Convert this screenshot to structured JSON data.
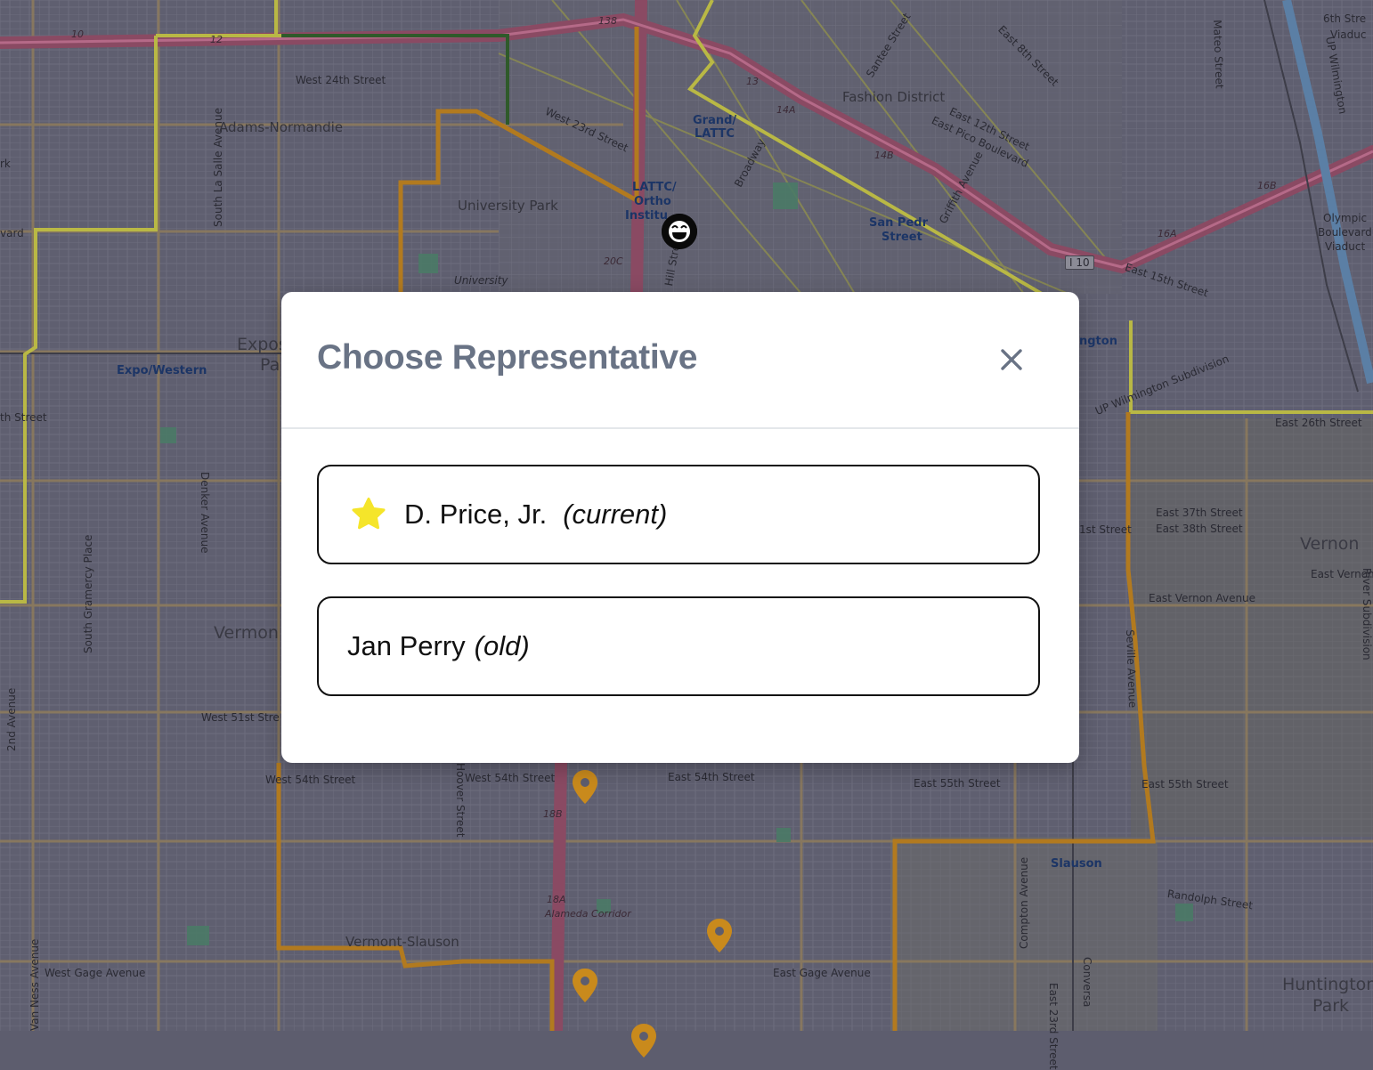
{
  "map": {
    "place_labels": [
      {
        "text": "West 24th Street"
      },
      {
        "text": "Adams-Normandie"
      },
      {
        "text": "University Park"
      },
      {
        "text": "West 23rd Street"
      },
      {
        "text": "Grand/"
      },
      {
        "text": "LATTC"
      },
      {
        "text": "LATTC/"
      },
      {
        "text": "Ortho"
      },
      {
        "text": "Institu"
      },
      {
        "text": "Broadway"
      },
      {
        "text": "Fashion District"
      },
      {
        "text": "East 12th Street"
      },
      {
        "text": "East Pico Boulevard"
      },
      {
        "text": "Griffith Avenue"
      },
      {
        "text": "San Pedr"
      },
      {
        "text": "Street"
      },
      {
        "text": "East 15th Street"
      },
      {
        "text": "Olympic"
      },
      {
        "text": "Boulevard"
      },
      {
        "text": "Viaduct"
      },
      {
        "text": "6th Stre"
      },
      {
        "text": "Viaduc"
      },
      {
        "text": "Mateo Street"
      },
      {
        "text": "East 8th Street"
      },
      {
        "text": "Santee Street"
      },
      {
        "text": "Expo/Western"
      },
      {
        "text": "Expos"
      },
      {
        "text": "Pa"
      },
      {
        "text": "South La Salle Avenue"
      },
      {
        "text": "Denker Avenue"
      },
      {
        "text": "South Gramercy Place"
      },
      {
        "text": "Vermon"
      },
      {
        "text": "West 51st Stre"
      },
      {
        "text": "West 54th Street"
      },
      {
        "text": "Hoover Street"
      },
      {
        "text": "West 54th Street"
      },
      {
        "text": "East 54th Street"
      },
      {
        "text": "East 55th Street"
      },
      {
        "text": "East 55th Street"
      },
      {
        "text": "Vermont-Slauson"
      },
      {
        "text": "West Gage Avenue"
      },
      {
        "text": "East Gage Avenue"
      },
      {
        "text": "Slauson"
      },
      {
        "text": "Randolph Street"
      },
      {
        "text": "Compton Avenue"
      },
      {
        "text": "Huntington"
      },
      {
        "text": "Park"
      },
      {
        "text": "Vernon"
      },
      {
        "text": "East Vernon"
      },
      {
        "text": "East Vernon Avenue"
      },
      {
        "text": "East 37th Street"
      },
      {
        "text": "East 38th Street"
      },
      {
        "text": "East 26th Street"
      },
      {
        "text": "UP Wilmington Subdivision"
      },
      {
        "text": "ngton"
      },
      {
        "text": "1st Street"
      },
      {
        "text": "2nd Avenue"
      },
      {
        "text": "Van Ness Avenue"
      },
      {
        "text": "th Street"
      },
      {
        "text": "rk"
      },
      {
        "text": "vard"
      },
      {
        "text": "University"
      },
      {
        "text": "Hill Street"
      },
      {
        "text": "I 10"
      },
      {
        "text": "10"
      },
      {
        "text": "12"
      },
      {
        "text": "138"
      },
      {
        "text": "13"
      },
      {
        "text": "14A"
      },
      {
        "text": "14B"
      },
      {
        "text": "16A"
      },
      {
        "text": "16B"
      },
      {
        "text": "20C"
      },
      {
        "text": "18B"
      },
      {
        "text": "18A"
      },
      {
        "text": "Alameda Corridor"
      },
      {
        "text": "Seville Avenue"
      },
      {
        "text": "River Subdivision"
      },
      {
        "text": "UP Wilmington"
      },
      {
        "text": "Conversa"
      },
      {
        "text": "East 23rd Street"
      }
    ],
    "markers": {
      "user_icon": "smiley-face-icon",
      "pin_icon": "map-pin-icon",
      "pin_color": "#c98a1c"
    },
    "colors": {
      "dim_overlay": "#5d5d6e",
      "district_boundary_orange": "#b27a1f",
      "district_boundary_yellow": "#b9b845",
      "freeway": "#8a4a63",
      "railway_blue": "#5b7fa5"
    }
  },
  "modal": {
    "title": "Choose Representative",
    "close_icon": "close-icon",
    "options": [
      {
        "name": "D. Price, Jr.",
        "tag": "(current)",
        "icon": "star-icon",
        "icon_color": "#f5e52a"
      },
      {
        "name": "Jan Perry",
        "tag": "(old)"
      }
    ]
  }
}
